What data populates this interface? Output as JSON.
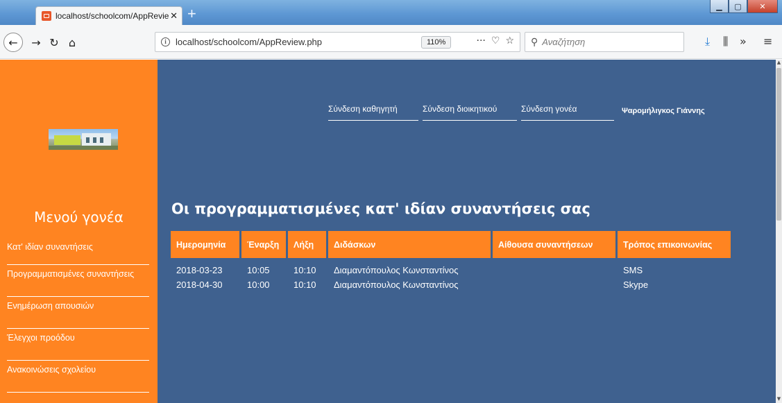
{
  "browser": {
    "tab_title": "localhost/schoolcom/AppReview",
    "url": "localhost/schoolcom/AppReview.php",
    "zoom": "110%",
    "search_placeholder": "Αναζήτηση"
  },
  "header": {
    "nav": [
      {
        "label": "Σύνδεση καθηγητή"
      },
      {
        "label": "Σύνδεση διοικητικού"
      },
      {
        "label": "Σύνδεση γονέα"
      }
    ],
    "user_name": "Ψαρομήλιγκος Γιάννης"
  },
  "sidebar": {
    "heading": "Μενού γονέα",
    "items": [
      {
        "label": "Κατ' ιδίαν συναντήσεις"
      },
      {
        "label": "Προγραμματισμένες συναντήσεις"
      },
      {
        "label": "Ενημέρωση απουσιών"
      },
      {
        "label": "Έλεγχοι προόδου"
      },
      {
        "label": "Ανακοινώσεις σχολείου"
      }
    ]
  },
  "main": {
    "title": "Οι προγραμματισμένες κατ' ιδίαν συναντήσεις σας",
    "table": {
      "columns": [
        "Ημερομηνία",
        "Έναρξη",
        "Λήξη",
        "Διδάσκων",
        "Αίθουσα συναντήσεων",
        "Τρόπος επικοινωνίας"
      ],
      "rows": [
        [
          "2018-03-23",
          "10:05",
          "10:10",
          "Διαμαντόπουλος Κωνσταντίνος",
          "",
          "SMS"
        ],
        [
          "2018-04-30",
          "10:00",
          "10:10",
          "Διαμαντόπουλος Κωνσταντίνος",
          "",
          "Skype"
        ]
      ]
    }
  },
  "colors": {
    "sidebar_bg": "#ff8421",
    "content_bg": "#3f618f",
    "table_header_bg": "#ff8421"
  }
}
